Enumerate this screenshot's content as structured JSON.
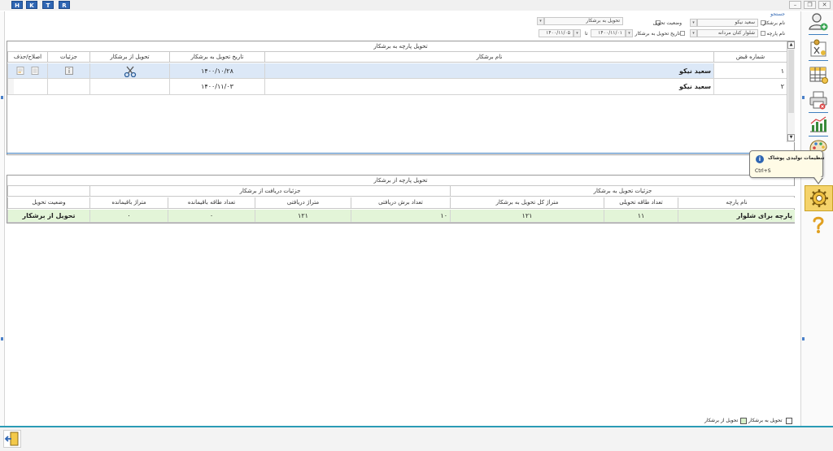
{
  "topbar": {
    "hotkeys": [
      "H",
      "K",
      "T",
      "R"
    ]
  },
  "filters": {
    "group_title": "جستجو",
    "tailor_name_label": "نام برشکار",
    "tailor_name_value": "سعید نیکو",
    "delivery_status_label": "وضعیت تحویل",
    "delivery_status_value": "تحویل به برشکار",
    "fabric_name_label": "نام پارچه",
    "fabric_name_value": "شلوار کتان مردانه",
    "delivery_date_label": "تاریخ تحویل به برشکار",
    "date_from": "۱۴۰۰/۱۱/۰۱",
    "date_to_label": "تا",
    "date_to": "۱۴۰۰/۱۱/۰۵"
  },
  "upper_grid": {
    "title": "تحویل پارچه به برشکار",
    "columns": {
      "receipt_no": "شماره قبض",
      "tailor": "نام برشکار",
      "date": "تاریخ تحویل به برشکار",
      "deliver_from": "تحویل از برشکار",
      "details": "جزئیات",
      "edit_delete": "اصلاح/حذف"
    },
    "rows": [
      {
        "receipt_no": "۱",
        "tailor": "سعید نیکو",
        "date": "۱۴۰۰/۱۰/۲۸"
      },
      {
        "receipt_no": "۲",
        "tailor": "سعید نیکو",
        "date": "۱۴۰۰/۱۱/۰۳"
      }
    ]
  },
  "lower_grid": {
    "title": "تحویل پارچه از برشکار",
    "group_delivery": "جزئیات تحویل به برشکار",
    "group_receive": "جزئیات دریافت از برشکار",
    "columns": {
      "fabric_name": "نام پارچه",
      "delivered_rolls": "تعداد طاقه تحویلی",
      "total_meters": "متراژ کل تحویل به برشکار",
      "received_cuts": "تعداد برش دریافتی",
      "received_meters": "متراژ دریافتی",
      "remaining_rolls": "تعداد طاقه باقیمانده",
      "remaining_meters": "متراژ باقیمانده",
      "status": "وضعیت تحویل"
    },
    "rows": [
      {
        "fabric_name": "پارچه برای شلوار",
        "delivered_rolls": "۱۱",
        "total_meters": "۱۲۱",
        "received_cuts": "۱۰",
        "received_meters": "۱۲۱",
        "remaining_rolls": "۰",
        "remaining_meters": "۰",
        "status": "تحویل از برشکار"
      }
    ]
  },
  "tooltip": {
    "title": "تنظیمات تولیدی پوشاک",
    "shortcut": "Ctrl+S"
  },
  "legend": {
    "to_tailor": "تحویل به برشکار",
    "from_tailor": "تحویل از برشکار"
  },
  "colors": {
    "accent": "#3f7fbf",
    "selected_row": "#dce8f7",
    "delivered_row": "#e3f5d8",
    "active_tool": "#f5d36a"
  }
}
